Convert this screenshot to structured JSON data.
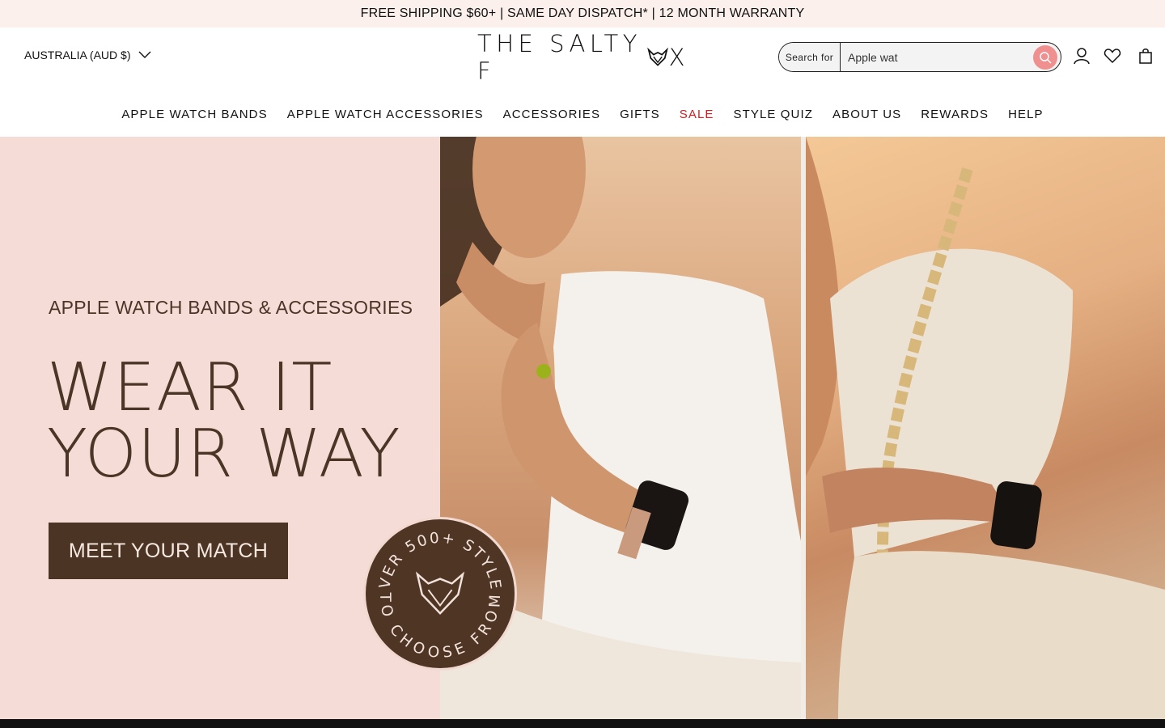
{
  "announcement": "FREE SHIPPING $60+ | SAME DAY DISPATCH* | 12 MONTH WARRANTY",
  "header": {
    "region": "AUSTRALIA (AUD $)",
    "logo": {
      "before": "THE SALTY F",
      "after": "X"
    },
    "search": {
      "label": "Search for",
      "value": "Apple wat"
    },
    "icons": [
      "account-icon",
      "wishlist-heart-icon",
      "cart-bag-icon"
    ]
  },
  "nav": [
    {
      "label": "APPLE WATCH BANDS",
      "sale": false
    },
    {
      "label": "APPLE WATCH ACCESSORIES",
      "sale": false
    },
    {
      "label": "ACCESSORIES",
      "sale": false
    },
    {
      "label": "GIFTS",
      "sale": false
    },
    {
      "label": "SALE",
      "sale": true
    },
    {
      "label": "STYLE QUIZ",
      "sale": false
    },
    {
      "label": "ABOUT US",
      "sale": false
    },
    {
      "label": "REWARDS",
      "sale": false
    },
    {
      "label": "HELP",
      "sale": false
    }
  ],
  "hero": {
    "eyebrow": "APPLE WATCH BANDS & ACCESSORIES",
    "headline_line1": "WEAR IT",
    "headline_line2": "YOUR WAY",
    "cta": "MEET YOUR MATCH",
    "badge_top": "OVER 500+ STYLES",
    "badge_bottom": "TO CHOOSE FROM"
  },
  "colors": {
    "announcement_bg": "#fbf0ec",
    "hero_pink": "#f6dcd6",
    "brown": "#4b3423",
    "sale_red": "#d61c1c",
    "search_button": "#ef8f8f"
  }
}
